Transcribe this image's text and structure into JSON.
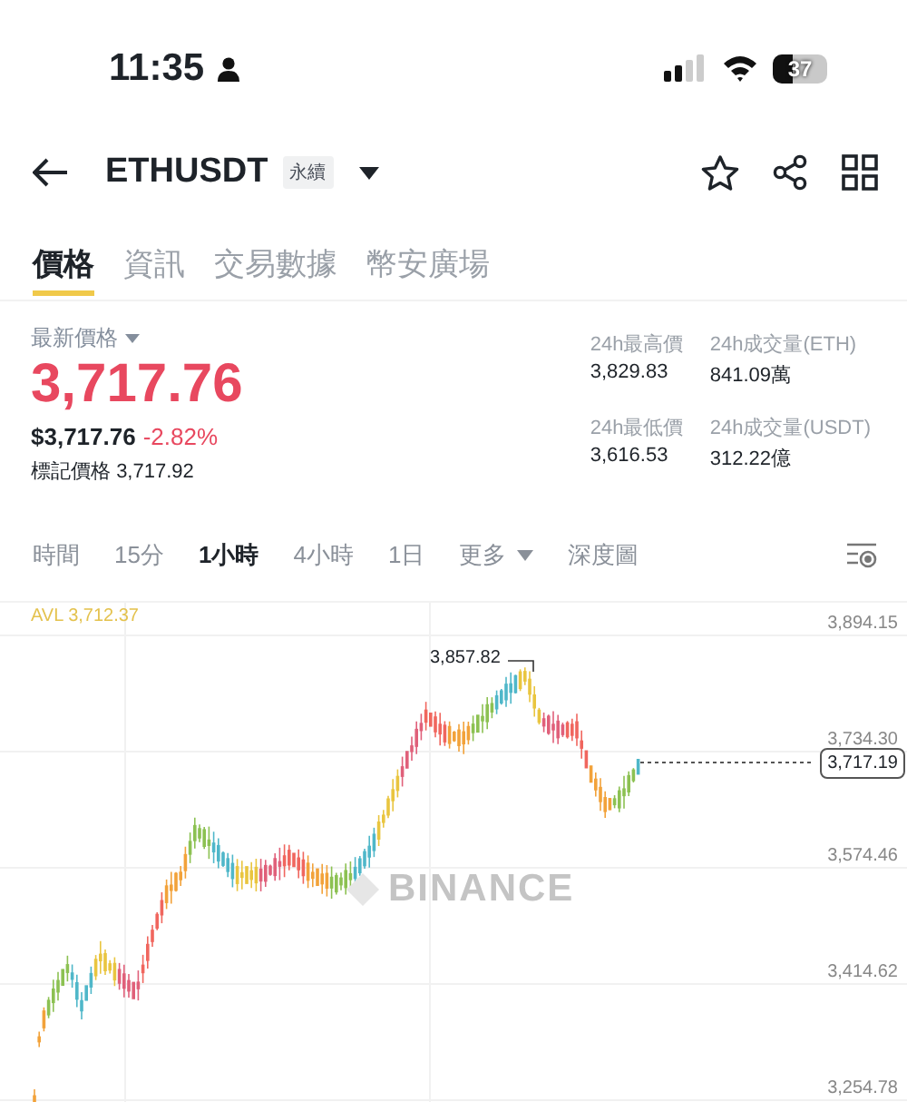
{
  "status_bar": {
    "time": "11:35",
    "battery": "37"
  },
  "header": {
    "symbol": "ETHUSDT",
    "contract_tag": "永續"
  },
  "tabs": [
    {
      "label": "價格",
      "selected": true
    },
    {
      "label": "資訊",
      "selected": false
    },
    {
      "label": "交易數據",
      "selected": false
    },
    {
      "label": "幣安廣場",
      "selected": false
    }
  ],
  "price": {
    "caption": "最新價格",
    "last": "3,717.76",
    "usd": "$3,717.76",
    "change": "-2.82%",
    "mark_label": "標記價格",
    "mark_value": "3,717.92"
  },
  "stats": [
    {
      "label": "24h最高價",
      "value": "3,829.83"
    },
    {
      "label": "24h成交量(ETH)",
      "value": "841.09萬"
    },
    {
      "label": "24h最低價",
      "value": "3,616.53"
    },
    {
      "label": "24h成交量(USDT)",
      "value": "312.22億"
    }
  ],
  "intervals": [
    {
      "label": "時間",
      "kind": "option",
      "selected": false
    },
    {
      "label": "15分",
      "kind": "option",
      "selected": false
    },
    {
      "label": "1小時",
      "kind": "option",
      "selected": true
    },
    {
      "label": "4小時",
      "kind": "option",
      "selected": false
    },
    {
      "label": "1日",
      "kind": "option",
      "selected": false
    },
    {
      "label": "更多",
      "kind": "dropdown",
      "selected": false
    },
    {
      "label": "深度圖",
      "kind": "option",
      "selected": false
    }
  ],
  "chart": {
    "avl": "AVL 3,712.37",
    "high_label": "3,857.82",
    "current": "3,717.19",
    "watermark": "BINANCE",
    "price_ticks": [
      "3,894.15",
      "3,734.30",
      "3,574.46",
      "3,414.62",
      "3,254.78"
    ]
  }
}
